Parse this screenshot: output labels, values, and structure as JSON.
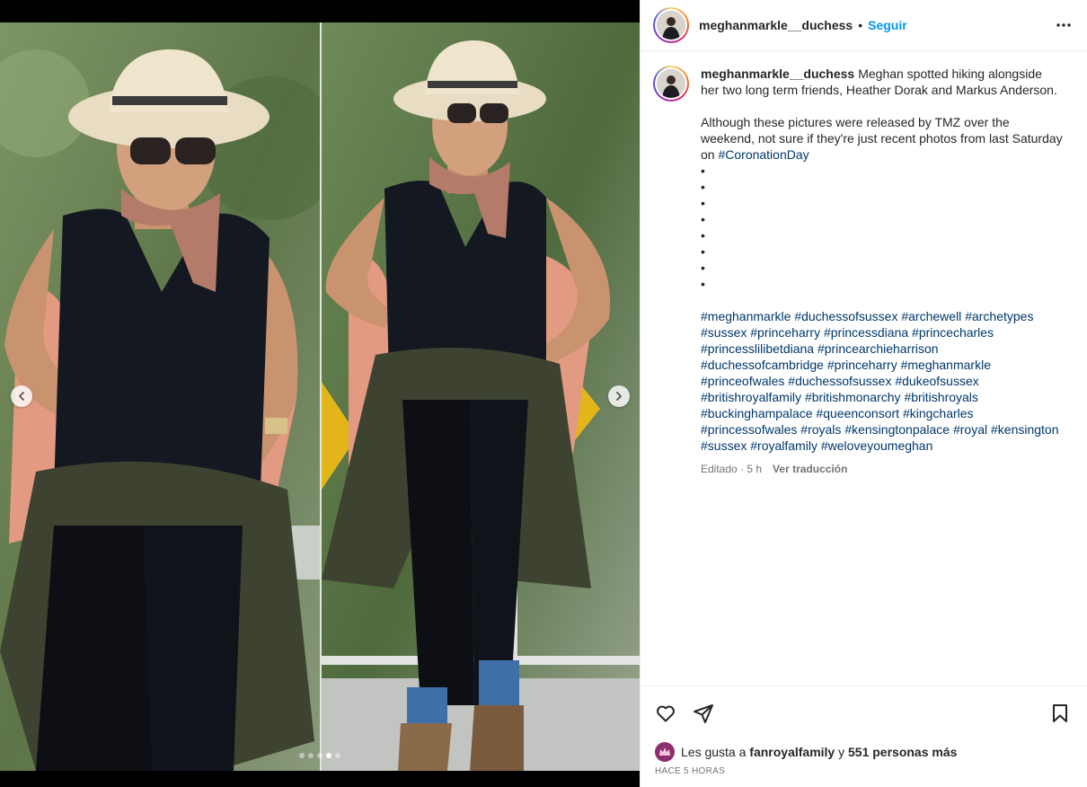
{
  "post": {
    "username": "meghanmarkle__duchess",
    "separator": "•",
    "follow_label": "Seguir",
    "more_icon": "more-horizontal-icon"
  },
  "media": {
    "carousel_total": 5,
    "carousel_active_index": 3,
    "colors": {
      "sky": "#6f8a5a",
      "shirt": "#141820",
      "jacket": "#3e4331",
      "hat": "#e8dcc2",
      "scarf": "#b47a6a",
      "skin": "#c9936f"
    }
  },
  "caption": {
    "username": "meghanmarkle__duchess",
    "text_1": "Meghan spotted hiking alongside her two long term friends, Heather Dorak and Markus Anderson.",
    "text_2_prefix": "Although these pictures were released by TMZ over the weekend, not sure if they're just recent photos from last Saturday on ",
    "text_2_tag": "#CoronationDay",
    "bullets": [
      "•",
      "•",
      "•",
      "•",
      "•",
      "•",
      "•",
      "•"
    ],
    "hashtags": [
      "#meghanmarkle",
      "#duchessofsussex",
      "#archewell",
      "#archetypes",
      "#sussex",
      "#princeharry",
      "#princessdiana",
      "#princecharles",
      "#princesslilibetdiana",
      "#princearchieharrison",
      "#duchessofcambridge",
      "#princeharry",
      "#meghanmarkle",
      "#princeofwales",
      "#duchessofsussex",
      "#dukeofsussex",
      "#britishroyalfamily",
      "#britishmonarchy",
      "#britishroyals",
      "#buckinghampalace",
      "#queenconsort",
      "#kingcharles",
      "#princessofwales",
      "#royals",
      "#kensingtonpalace",
      "#royal",
      "#kensington",
      "#sussex",
      "#royalfamily",
      "#weloveyoumeghan"
    ],
    "edited_label": "Editado · 5 h",
    "translate_label": "Ver traducción"
  },
  "likes": {
    "prefix": "Les gusta a",
    "liker": "fanroyalfamily",
    "connector": "y",
    "others": "551 personas más"
  },
  "timestamp": "HACE 5 HORAS"
}
